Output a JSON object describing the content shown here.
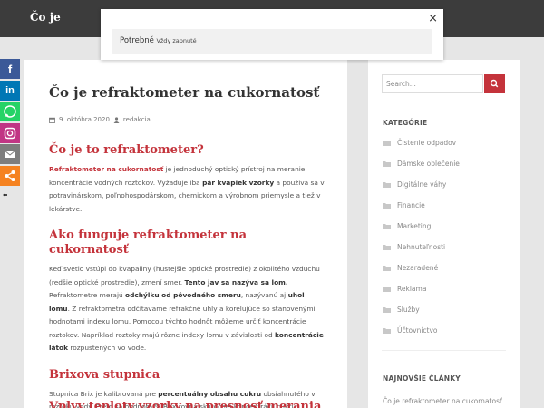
{
  "site": {
    "title": "Čo je"
  },
  "modal": {
    "label": "Potrebné",
    "sub": "Vždy zapnuté",
    "close": "×"
  },
  "post": {
    "title": "Čo je refraktometer na cukornatosť",
    "date": "9. októbra 2020",
    "author": "redakcia"
  },
  "sections": [
    {
      "heading": "Čo je to refraktometer?",
      "p": [
        {
          "b": "Refraktometer na cukornatosť",
          "red": true
        },
        {
          "t": " je jednoduchý optický prístroj na meranie koncentrácie vodných roztokov. Vyžaduje iba "
        },
        {
          "b": "pár kvapiek vzorky"
        },
        {
          "t": " a používa sa v potravinárskom, poľnohospodárskom, chemickom a výrobnom priemysle a tiež v lekárstve."
        }
      ]
    },
    {
      "heading": "Ako funguje refraktometer na cukornatosť",
      "p": [
        {
          "t": "Keď svetlo vstúpi do kvapaliny (hustejšie optické prostredie) z okolitého vzduchu (redšie optické prostredie), zmení smer. "
        },
        {
          "b": "Tento jav sa nazýva sa lom."
        },
        {
          "t": " Refraktometre merajú "
        },
        {
          "b": "odchýlku od pôvodného smeru"
        },
        {
          "t": ", nazývanú aj "
        },
        {
          "b": "uhol lomu"
        },
        {
          "t": ". Z refraktometra odčítavame refrakčné uhly a korelujúce so stanovenými hodnotami indexu lomu. Pomocou týchto hodnôt môžeme určiť koncentrácie roztokov. Napríklad roztoky majú rôzne indexy lomu v závislosti od "
        },
        {
          "b": "koncentrácie látok"
        },
        {
          "t": " rozpustených vo vode."
        }
      ]
    },
    {
      "heading": "Brixova stupnica",
      "p": [
        {
          "t": "Stupnica Brix je kalibrovaná pre "
        },
        {
          "b": "percentuálny obsahu cukru"
        },
        {
          "t": " obsiahnutého v roztoku vody. Preto sa hodnota % Brix rovná skutočnej koncentrácii cukru."
        }
      ]
    }
  ],
  "partial_heading": "Vplyv teploty vzorky na presnosť merania",
  "sidebar": {
    "search_placeholder": "Search...",
    "categories_heading": "KATEGÓRIE",
    "categories": [
      "Čistenie odpadov",
      "Dámske oblečenie",
      "Digitálne váhy",
      "Financie",
      "Marketing",
      "Nehnuteľnosti",
      "Nezaradené",
      "Reklama",
      "Služby",
      "Účtovníctvo"
    ],
    "recent_heading": "NAJNOVŠIE ČLÁNKY",
    "recent": [
      "Čo je refraktometer na cukornatosť"
    ]
  },
  "social": [
    {
      "name": "facebook",
      "color": "#3b5998",
      "glyph": "f"
    },
    {
      "name": "linkedin",
      "color": "#0077b5",
      "glyph": "in"
    },
    {
      "name": "whatsapp",
      "color": "#25d366",
      "glyph": ""
    },
    {
      "name": "instagram",
      "color": "#c13584",
      "glyph": ""
    },
    {
      "name": "email",
      "color": "#7d7d7d",
      "glyph": ""
    },
    {
      "name": "share",
      "color": "#f58220",
      "glyph": ""
    }
  ],
  "colors": {
    "accent": "#c4333b",
    "topbar": "#3c3c3c"
  }
}
